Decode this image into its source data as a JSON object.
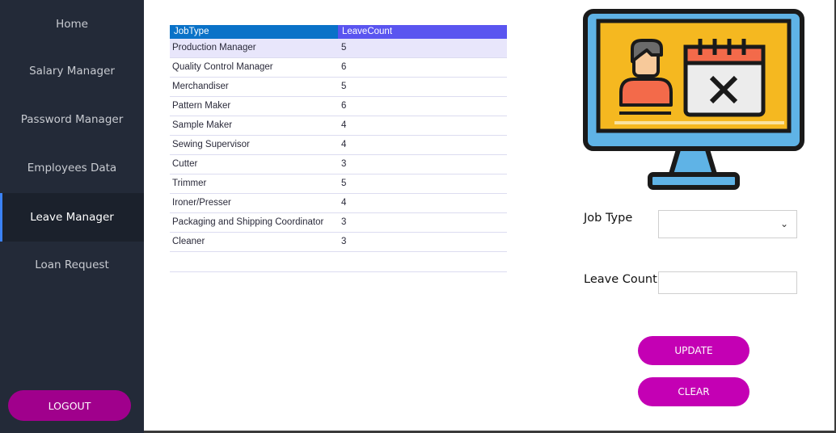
{
  "sidebar": {
    "items": [
      {
        "label": "Home",
        "active": false
      },
      {
        "label": "Salary Manager",
        "active": false
      },
      {
        "label": "Password Manager",
        "active": false
      },
      {
        "label": "Employees Data",
        "active": false
      },
      {
        "label": "Leave Manager",
        "active": true
      },
      {
        "label": "Loan Request",
        "active": false
      }
    ],
    "logout_label": "LOGOUT"
  },
  "grid": {
    "columns": [
      "JobType",
      "LeaveCount"
    ],
    "rows": [
      {
        "job": "Production Manager",
        "count": "5"
      },
      {
        "job": "Quality Control Manager",
        "count": "6"
      },
      {
        "job": "Merchandiser",
        "count": "5"
      },
      {
        "job": "Pattern Maker",
        "count": "6"
      },
      {
        "job": "Sample Maker",
        "count": "4"
      },
      {
        "job": "Sewing Supervisor",
        "count": "4"
      },
      {
        "job": "Cutter",
        "count": "3"
      },
      {
        "job": "Trimmer",
        "count": "5"
      },
      {
        "job": "Ironer/Presser",
        "count": "4"
      },
      {
        "job": "Packaging and Shipping Coordinator",
        "count": "3"
      },
      {
        "job": "Cleaner",
        "count": "3"
      }
    ],
    "selected_row": 0
  },
  "form": {
    "job_type_label": "Job Type",
    "job_type_value": "",
    "leave_count_label": "Leave Count",
    "leave_count_value": ""
  },
  "buttons": {
    "update": "UPDATE",
    "clear": "CLEAR"
  },
  "colors": {
    "sidebar_bg": "#232a38",
    "active_bar": "#3b82f6",
    "logout_bg": "#a0008c",
    "action_btn": "#c400b4",
    "grid_header_1": "#0a72c8",
    "grid_header_2": "#5a55f0"
  },
  "illustration": {
    "icon": "monitor-leave-calendar-icon"
  }
}
